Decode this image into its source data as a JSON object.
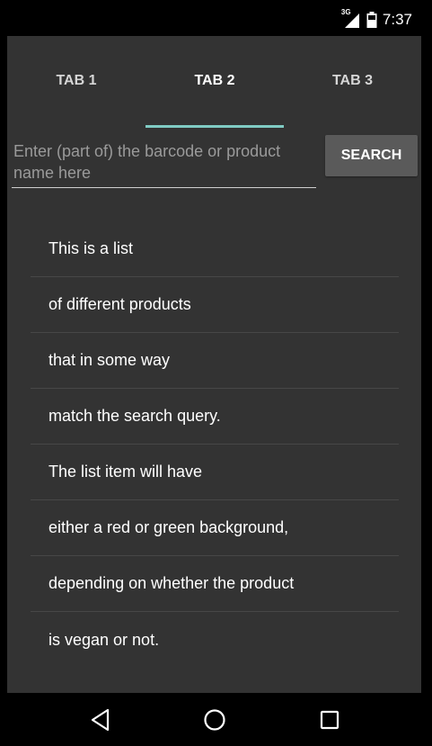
{
  "status_bar": {
    "network_label": "3G",
    "time": "7:37",
    "icons": [
      "signal-icon",
      "battery-icon"
    ]
  },
  "tabs": [
    {
      "label": "TAB 1",
      "selected": false
    },
    {
      "label": "TAB 2",
      "selected": true
    },
    {
      "label": "TAB 3",
      "selected": false
    }
  ],
  "search": {
    "placeholder": "Enter (part of) the barcode or product name here",
    "value": "",
    "button_label": "SEARCH"
  },
  "list": {
    "items": [
      {
        "label": "This is a list"
      },
      {
        "label": "of different products"
      },
      {
        "label": "that in some way"
      },
      {
        "label": "match the search query."
      },
      {
        "label": "The list item will have"
      },
      {
        "label": "either a red or green background,"
      },
      {
        "label": "depending on whether the product"
      },
      {
        "label": "is vegan or not."
      }
    ]
  },
  "nav_bar": {
    "icons": [
      "back-icon",
      "home-icon",
      "recents-icon"
    ]
  },
  "colors": {
    "background": "#333333",
    "tab_indicator": "#80cbc4",
    "button": "#5a5a5a",
    "divider": "#474747"
  }
}
